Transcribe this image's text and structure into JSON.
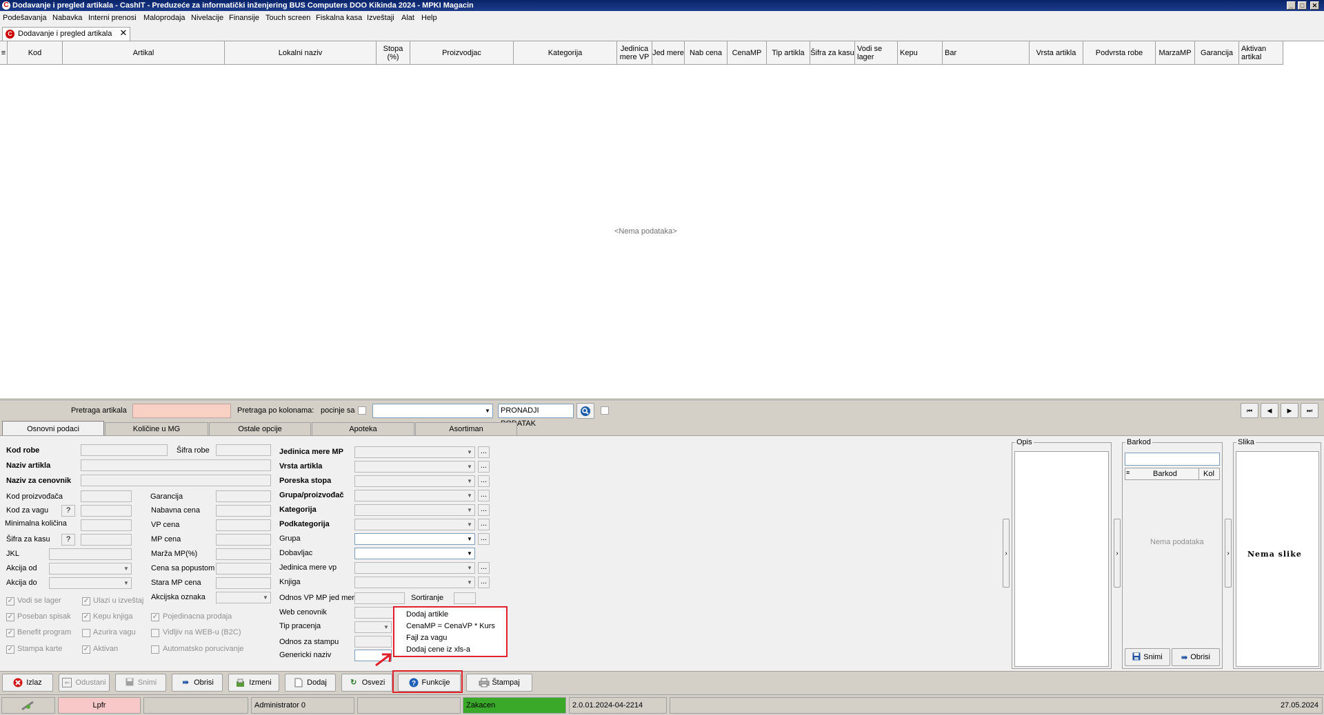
{
  "window": {
    "title": "Dodavanje i pregled artikala - CashIT - Preduzeće za informatički inženjering BUS Computers DOO Kikinda 2024 - MPKI Magacin",
    "controls": [
      "_",
      "□",
      "✕"
    ]
  },
  "menubar": [
    "Podešavanja",
    "Nabavka",
    "Interni prenosi",
    "Maloprodaja",
    "Nivelacije",
    "Finansije",
    "Touch screen",
    "Fiskalna kasa",
    "Izveštaji",
    "Alat",
    "Help"
  ],
  "doc_tab": {
    "label": "Dodavanje i pregled artikala",
    "close": "✕"
  },
  "grid": {
    "columns": [
      "Kod",
      "Artikal",
      "Lokalni naziv",
      "Stopa (%)",
      "Proizvodjac",
      "Kategorija",
      "Jedinica mere VP",
      "Jed mere",
      "Nab cena",
      "CenaMP",
      "Tip artikla",
      "Šifra za kasu",
      "Vodi se lager",
      "Kepu",
      "Bar",
      "Vrsta artikla",
      "Podvrsta robe",
      "MarzaMP",
      "Garancija",
      "Aktivan artikal"
    ],
    "empty_text": "<Nema podataka>"
  },
  "search": {
    "label": "Pretraga artikala",
    "column_label": "Pretraga po kolonama:",
    "starts_with": "pocinje sa",
    "find_button": "PRONADJI PODATAK",
    "nav": [
      "⏮",
      "◀",
      "▶",
      "⏭"
    ]
  },
  "form_tabs": [
    "Osnovni podaci",
    "Količine u MG",
    "Ostale opcije",
    "Apoteka",
    "Asortiman"
  ],
  "form": {
    "kod_robe": "Kod robe",
    "sifra_robe": "Šifra robe",
    "naziv_artikla": "Naziv artikla",
    "naziv_za_cenovnik": "Naziv za cenovnik",
    "kod_proizvodjaca": "Kod proizvođača",
    "kod_za_vagu": "Kod za vagu",
    "minimalna_kolicina": "Minimalna količina",
    "sifra_za_kasu": "Šifra za kasu",
    "jkl": "JKL",
    "akcija_od": "Akcija od",
    "akcija_do": "Akcija do",
    "garancija": "Garancija",
    "nabavna_cena": "Nabavna cena",
    "vp_cena": "VP cena",
    "mp_cena": "MP cena",
    "marza_mp": "Marža MP(%)",
    "cena_sa_popustom": "Cena sa popustom",
    "stara_mp_cena": "Stara MP cena",
    "akcijska_oznaka": "Akcijska oznaka",
    "q": "?",
    "jedinica_mere_mp": "Jedinica mere MP",
    "vrsta_artikla": "Vrsta artikla",
    "poreska_stopa": "Poreska stopa",
    "grupa_proizvodjac": "Grupa/proizvođač",
    "kategorija": "Kategorija",
    "podkategorija": "Podkategorija",
    "grupa": "Grupa",
    "dobavljac": "Dobavljac",
    "jedinica_mere_vp": "Jedinica mere vp",
    "knjiga": "Knjiga",
    "odnos_vp_mp": "Odnos VP MP jed mere",
    "sortiranje": "Sortiranje",
    "web_cenovnik": "Web cenovnik",
    "tip_pracenja": "Tip pracenja",
    "odnos_za_stampu": "Odnos za stampu",
    "genericki_naziv": "Genericki naziv",
    "ellipsis": "..."
  },
  "checkboxes": [
    {
      "label": "Vodi se lager",
      "checked": true
    },
    {
      "label": "Poseban spisak",
      "checked": true
    },
    {
      "label": "Benefit program",
      "checked": true
    },
    {
      "label": "Stampa karte",
      "checked": true
    },
    {
      "label": "Ulazi u izveštaj",
      "checked": true
    },
    {
      "label": "Kepu knjiga",
      "checked": true
    },
    {
      "label": "Azurira vagu",
      "checked": false
    },
    {
      "label": "Aktivan",
      "checked": true
    },
    {
      "label": "Pojedinacna prodaja",
      "checked": true
    },
    {
      "label": "Vidljiv na WEB-u (B2C)",
      "checked": false
    },
    {
      "label": "Automatsko porucivanje",
      "checked": false
    }
  ],
  "context_menu": [
    "Dodaj artikle",
    "CenaMP = CenaVP * Kurs",
    "Fajl za vagu",
    "Dodaj cene iz xls-a"
  ],
  "panels": {
    "opis": "Opis",
    "barkod": "Barkod",
    "barkod_col": "Barkod",
    "kol_col": "Kol",
    "barkod_empty": "Nema podataka",
    "snimi": "Snimi",
    "obrisi": "Obrisi",
    "slika": "Slika",
    "slika_empty": "Nema slike",
    "expander": "›"
  },
  "buttons": {
    "izlaz": "Izlaz",
    "odustani": "Odustani",
    "snimi": "Snimi",
    "obrisi": "Obrisi",
    "izmeni": "Izmeni",
    "dodaj": "Dodaj",
    "osvezi": "Osvezi",
    "funkcije": "Funkcije",
    "stampaj": "Štampaj"
  },
  "status": {
    "lpfr": "Lpfr",
    "user": "Administrator 0",
    "state": "Zakacen",
    "version": "2.0.01.2024-04-2214",
    "date": "27.05.2024"
  },
  "colors": {
    "title_bar": "#0a246a",
    "highlight": "#e0202a",
    "search_field": "#f8d0c4",
    "lpfr_panel": "#f8c8c8",
    "zakacen_panel": "#3aa828"
  }
}
